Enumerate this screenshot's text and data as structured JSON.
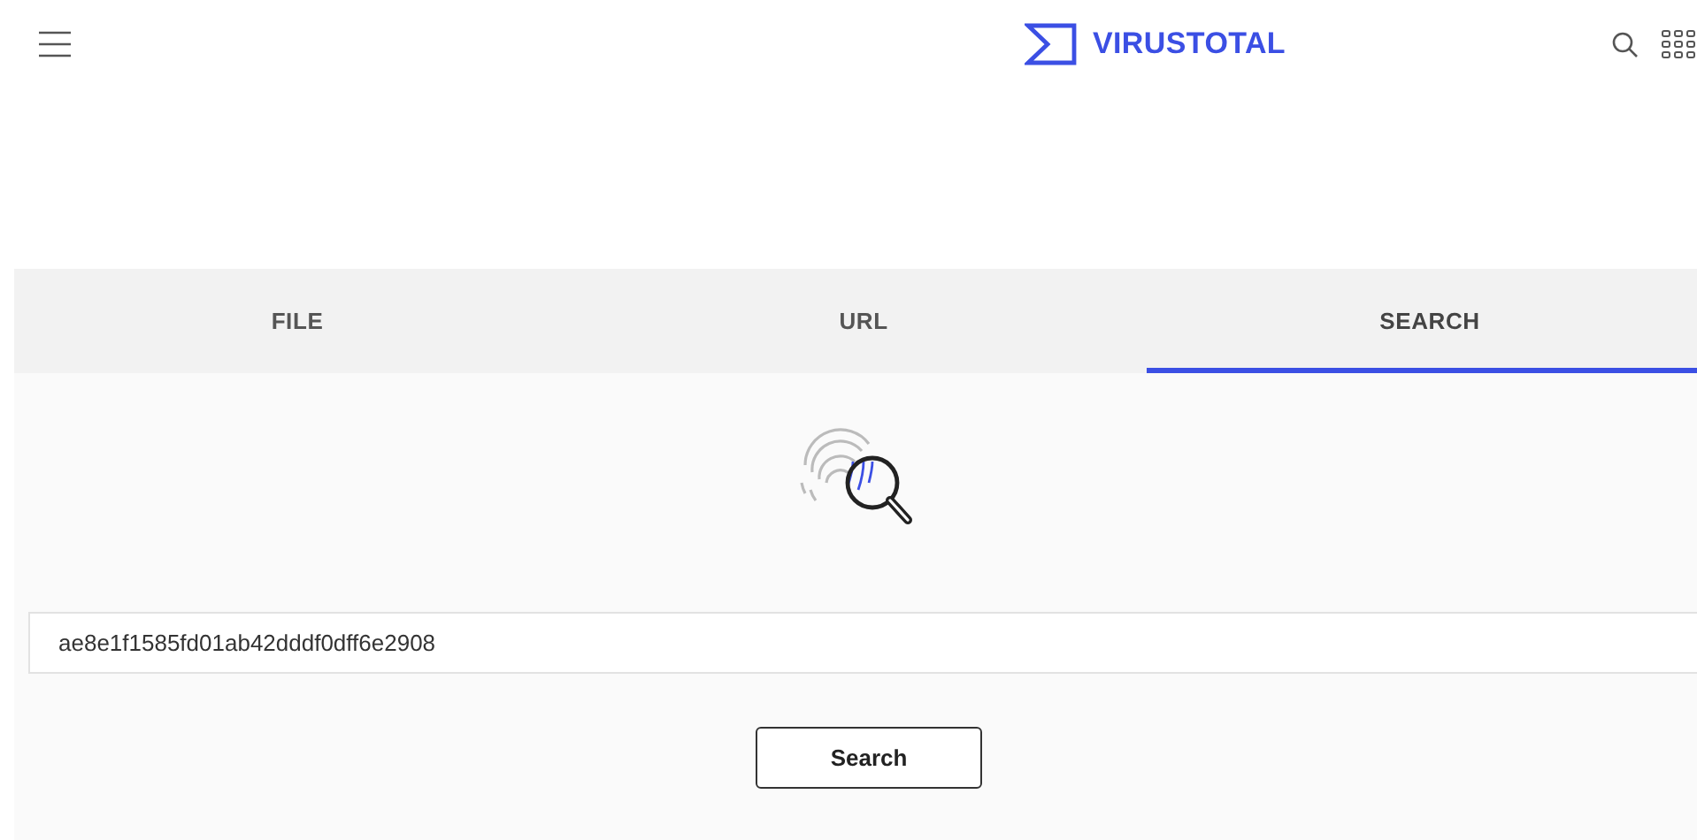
{
  "header": {
    "logo_text": "VIRUSTOTAL"
  },
  "tabs": [
    {
      "label": "FILE",
      "selected": false
    },
    {
      "label": "URL",
      "selected": false
    },
    {
      "label": "SEARCH",
      "selected": true
    }
  ],
  "search": {
    "value": "ae8e1f1585fd01ab42dddf0dff6e2908"
  },
  "buttons": [
    {
      "label": "Search"
    }
  ]
}
